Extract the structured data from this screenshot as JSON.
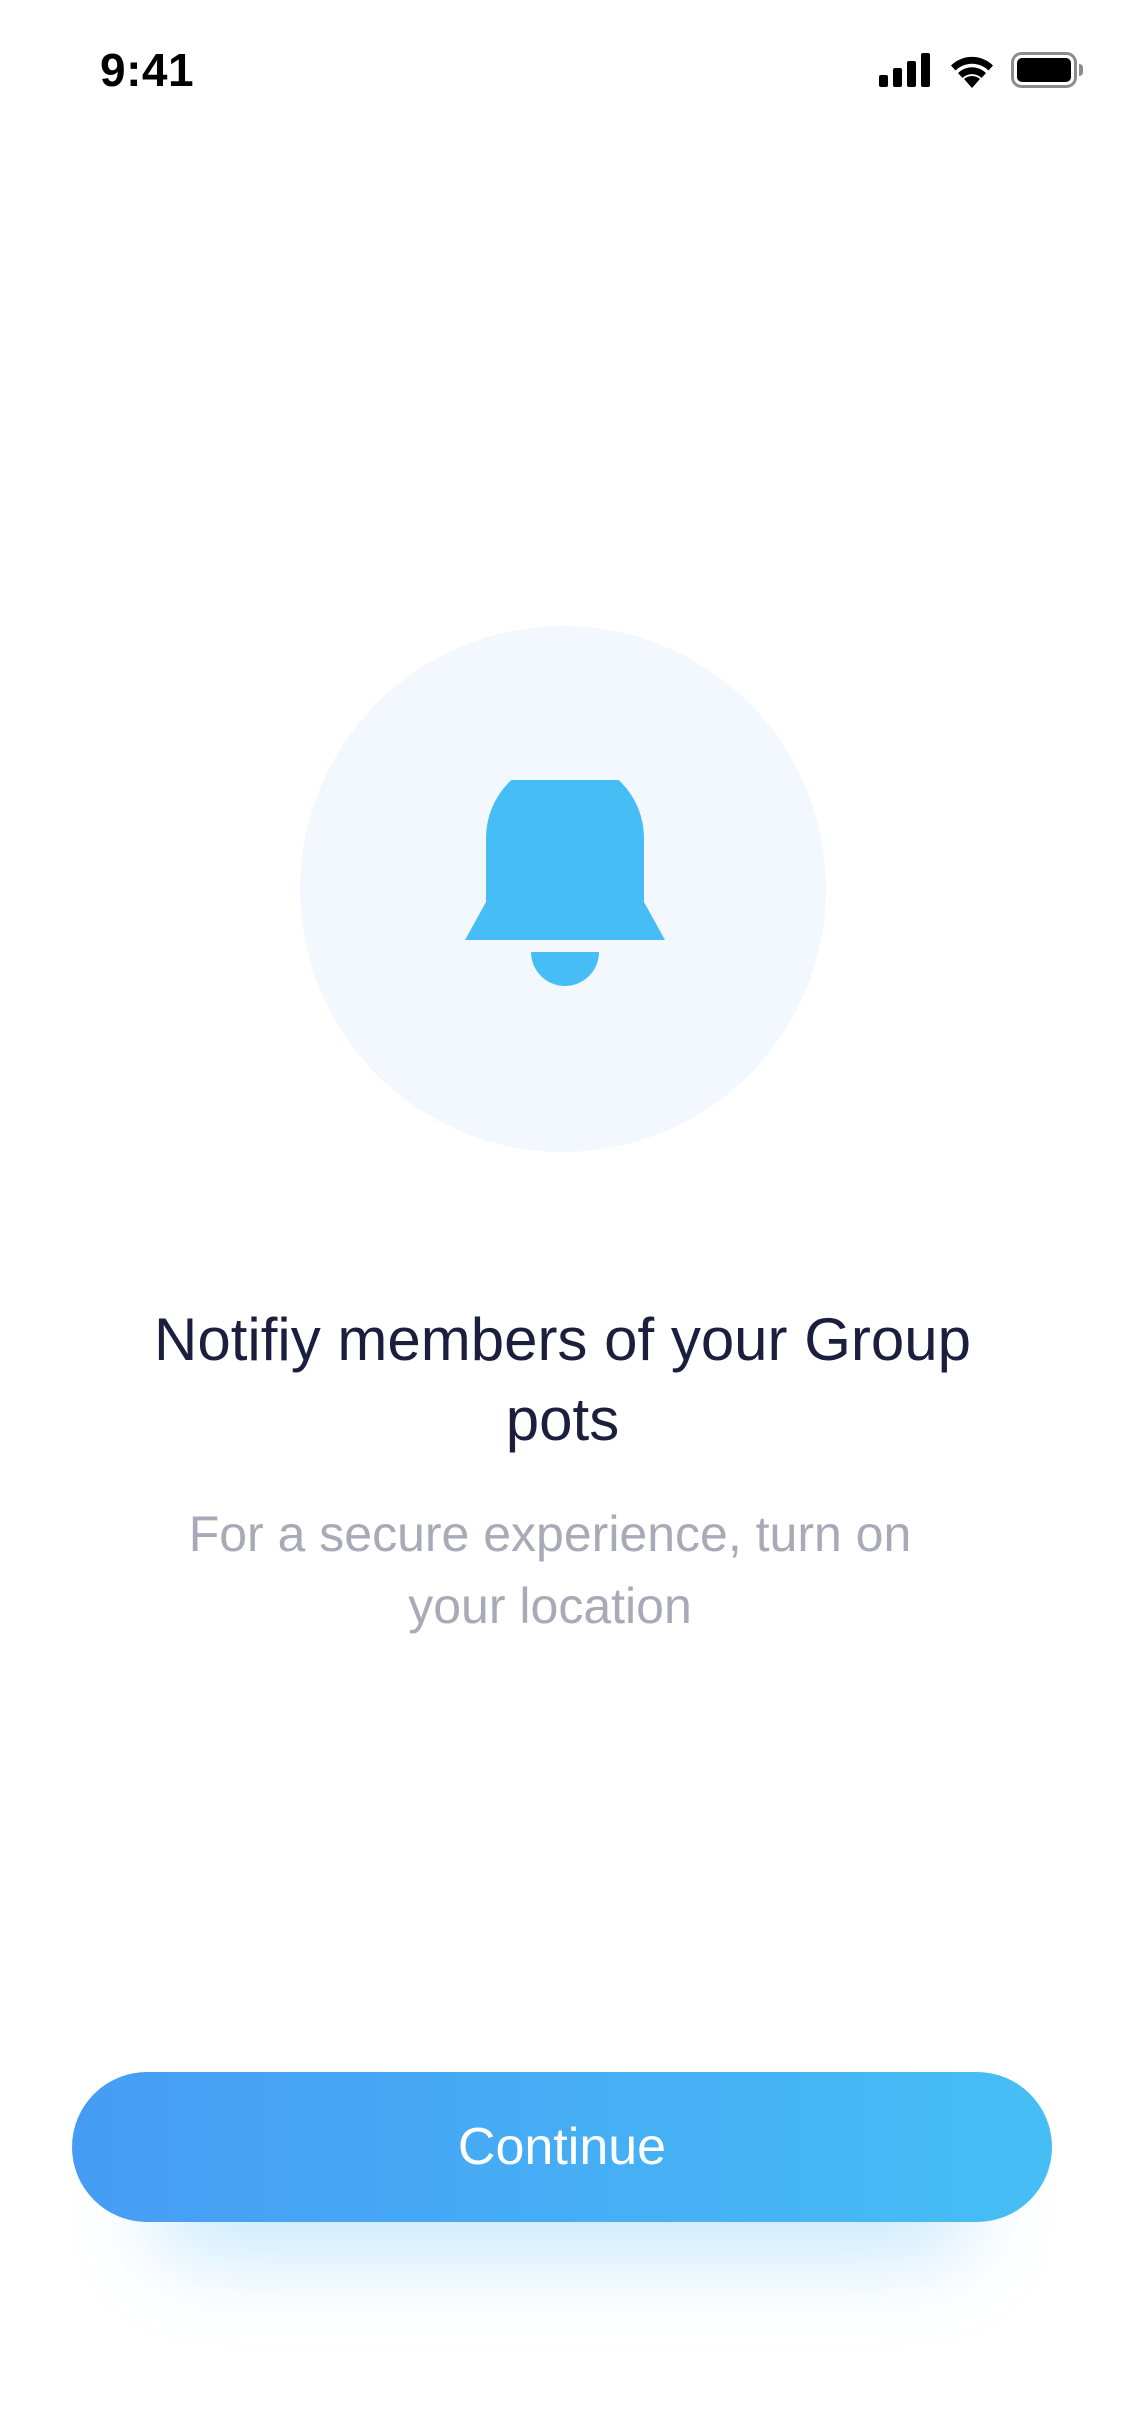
{
  "status_bar": {
    "time": "9:41",
    "icons": [
      "cellular-signal-icon",
      "wifi-icon",
      "battery-icon"
    ]
  },
  "illustration": {
    "icon": "bell-icon",
    "circle_color": "#f3f8fe",
    "icon_color": "#46bef5"
  },
  "content": {
    "title": "Notifiy members of your Group pots",
    "subtitle": "For a secure experience, turn on your location"
  },
  "actions": {
    "continue_label": "Continue"
  },
  "colors": {
    "title_text": "#1b1e3d",
    "subtitle_text": "#a8aab8",
    "button_gradient_start": "#469cf5",
    "button_gradient_end": "#46bef5"
  }
}
